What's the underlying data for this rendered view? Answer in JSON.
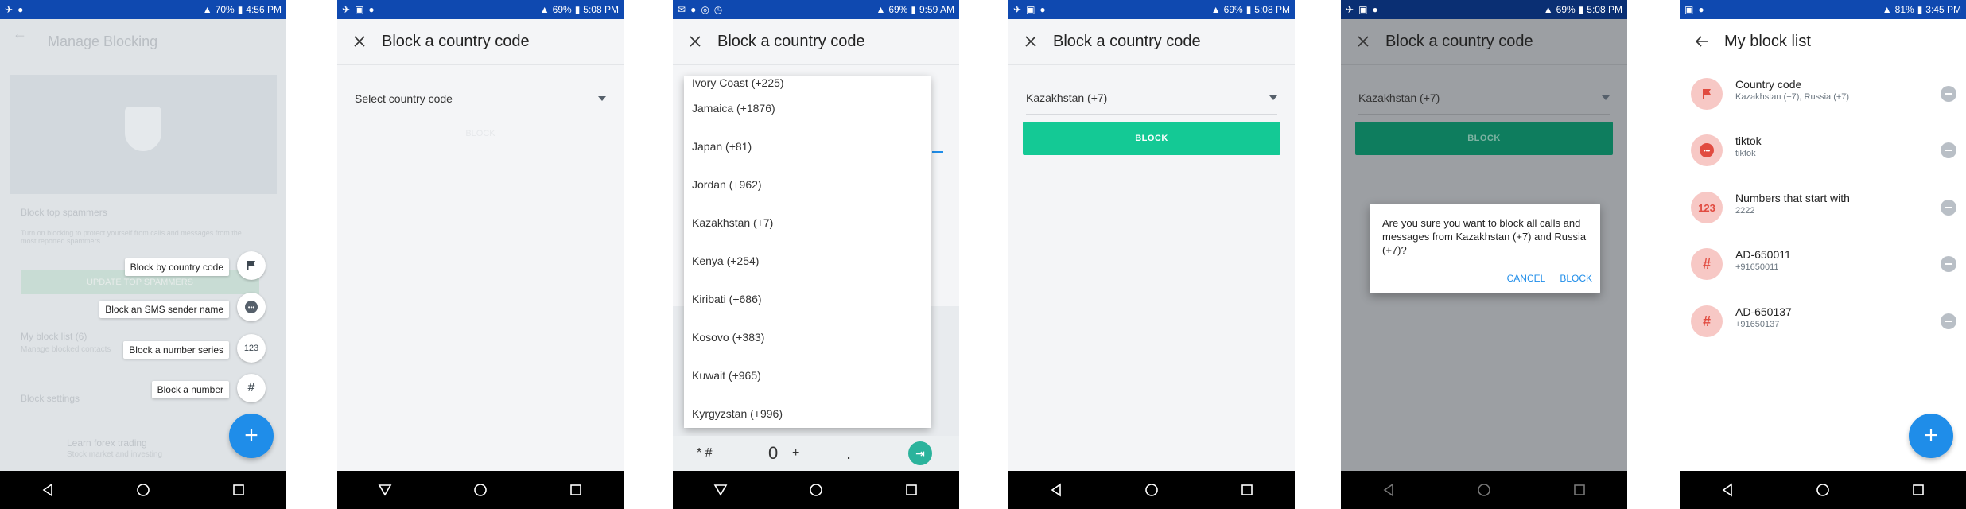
{
  "screens": [
    {
      "status": {
        "time": "4:56 PM",
        "battery": "70%"
      },
      "title": "Manage Blocking",
      "bg_texts": {
        "spammers_title": "Block top spammers",
        "spammers_desc": "Turn on blocking to protect yourself from calls and messages from the most reported spammers",
        "update_button": "UPDATE TOP SPAMMERS",
        "my_list": "My block list (6)",
        "my_list_desc": "Manage blocked contacts",
        "settings": "Block settings",
        "ad_title": "Learn forex trading",
        "ad_desc": "Stock market and investing"
      },
      "fab_menu": [
        {
          "label": "Block by country code",
          "icon": "flag-icon"
        },
        {
          "label": "Block an SMS sender name",
          "icon": "message-icon"
        },
        {
          "label": "Block a number series",
          "icon": "123"
        },
        {
          "label": "Block a number",
          "icon": "#"
        }
      ]
    },
    {
      "status": {
        "time": "5:08 PM",
        "battery": "69%"
      },
      "title": "Block a country code",
      "select_placeholder": "Select country code",
      "block_label": "BLOCK"
    },
    {
      "status": {
        "time": "9:59 AM",
        "battery": "69%"
      },
      "title": "Block a country code",
      "options": [
        "Ivory Coast (+225)",
        "Jamaica (+1876)",
        "Japan (+81)",
        "Jordan (+962)",
        "Kazakhstan (+7)",
        "Kenya (+254)",
        "Kiribati (+686)",
        "Kosovo (+383)",
        "Kuwait (+965)",
        "Kyrgyzstan (+996)"
      ],
      "keys": {
        "star_hash": "* #",
        "zero": "0",
        "plus": "+",
        "dot": "."
      }
    },
    {
      "status": {
        "time": "5:08 PM",
        "battery": "69%"
      },
      "title": "Block a country code",
      "selected": "Kazakhstan (+7)",
      "block_label": "BLOCK",
      "accent": "#14c995"
    },
    {
      "status": {
        "time": "5:08 PM",
        "battery": "69%"
      },
      "title": "Block a country code",
      "selected": "Kazakhstan (+7)",
      "block_label": "BLOCK",
      "dialog": {
        "message": "Are you sure you want to block all calls and messages from Kazakhstan (+7) and Russia (+7)?",
        "cancel": "CANCEL",
        "confirm": "BLOCK"
      }
    },
    {
      "status": {
        "time": "3:45 PM",
        "battery": "81%"
      },
      "title": "My block list",
      "items": [
        {
          "title": "Country code",
          "subtitle": "Kazakhstan (+7), Russia (+7)",
          "icon": "flag-icon"
        },
        {
          "title": "tiktok",
          "subtitle": "tiktok",
          "icon": "message-icon"
        },
        {
          "title": "Numbers that start with",
          "subtitle": "2222",
          "icon": "123"
        },
        {
          "title": "AD-650011",
          "subtitle": "+91650011",
          "icon": "#"
        },
        {
          "title": "AD-650137",
          "subtitle": "+91650137",
          "icon": "#"
        }
      ]
    }
  ],
  "colors": {
    "statusbar": "#0f49b0",
    "fab": "#1f8de9",
    "accent_green": "#14c995",
    "avatar_red": "#e14b40"
  }
}
